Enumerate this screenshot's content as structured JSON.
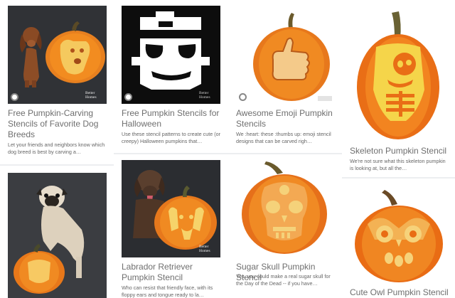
{
  "cards": [
    {
      "title": "Free Pumpkin-Carving Stencils of Favorite Dog Breeds",
      "desc": "Let your friends and neighbors know which dog breed is best by carving a…",
      "logo": "Better Homes"
    },
    {
      "title": "Free Pumpkin Stencils for Halloween",
      "desc": "Use these stencil patterns to create cute (or creepy) Halloween pumpkins that…",
      "logo": "Better Homes"
    },
    {
      "title": "Awesome Emoji Pumpkin Stencils",
      "desc": "We :heart: these :thumbs up: emoji stencil designs that can be carved righ…"
    },
    {
      "title": "Skeleton Pumpkin Stencil",
      "desc": "We're not sure what this skeleton pumpkin is looking at, but all the…"
    },
    {
      "title": "",
      "desc": ""
    },
    {
      "title": "Labrador Retriever Pumpkin Stencil",
      "desc": "Who can resist that friendly face, with its floppy ears and tongue ready to la…",
      "logo": "Better Homes"
    },
    {
      "title": "Sugar Skull Pumpkin Stencil",
      "desc": "Yes, you could make a real sugar skull for the Day of the Dead -- if you have…"
    },
    {
      "title": "Cute Owl Pumpkin Stencil",
      "desc": ""
    }
  ]
}
